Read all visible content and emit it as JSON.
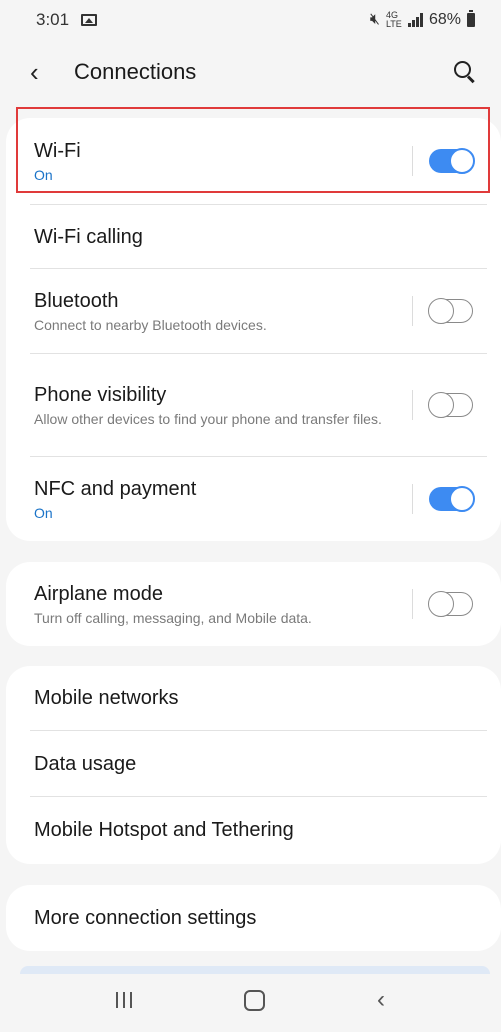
{
  "status_bar": {
    "time": "3:01",
    "network": "4G LTE",
    "battery": "68%"
  },
  "header": {
    "title": "Connections"
  },
  "group1": [
    {
      "label": "Wi-Fi",
      "sub": "On",
      "sub_on": true,
      "toggle": true
    },
    {
      "label": "Wi-Fi calling"
    },
    {
      "label": "Bluetooth",
      "sub": "Connect to nearby Bluetooth devices.",
      "toggle": false
    },
    {
      "label": "Phone visibility",
      "sub": "Allow other devices to find your phone and transfer files.",
      "toggle": false
    },
    {
      "label": "NFC and payment",
      "sub": "On",
      "sub_on": true,
      "toggle": true
    }
  ],
  "group2": [
    {
      "label": "Airplane mode",
      "sub": "Turn off calling, messaging, and Mobile data.",
      "toggle": false
    }
  ],
  "group3": [
    {
      "label": "Mobile networks"
    },
    {
      "label": "Data usage"
    },
    {
      "label": "Mobile Hotspot and Tethering"
    }
  ],
  "group4": [
    {
      "label": "More connection settings"
    }
  ],
  "colors": {
    "accent": "#3d8bf2",
    "on_text": "#1a73c8",
    "highlight": "#e03a3a"
  }
}
